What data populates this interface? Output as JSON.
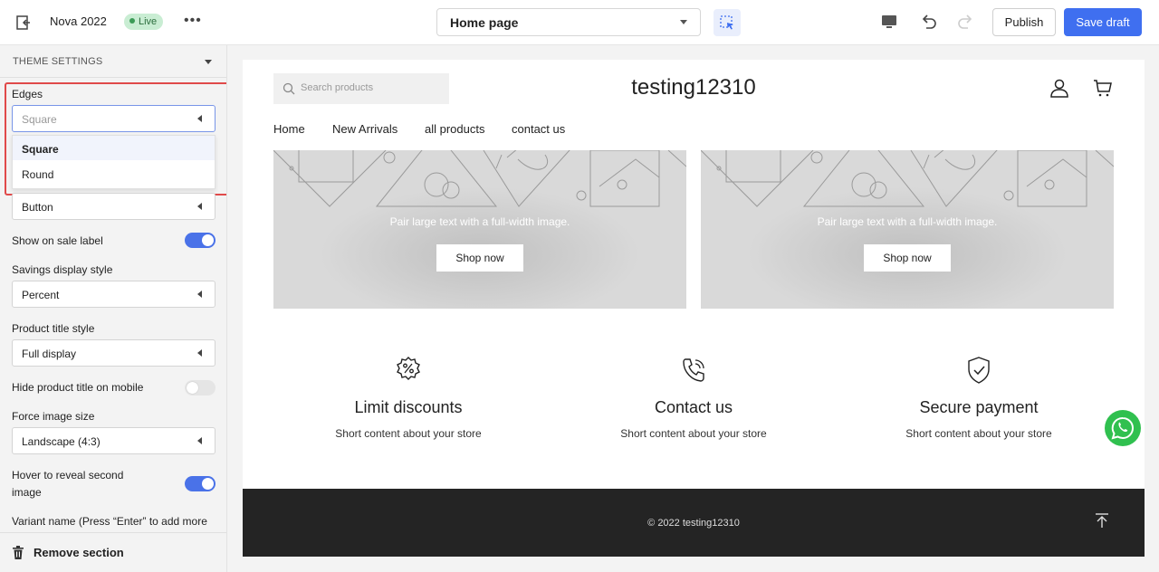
{
  "topbar": {
    "title": "Nova 2022",
    "live_badge": "Live",
    "more": "•••",
    "page_select": "Home page",
    "publish_label": "Publish",
    "save_label": "Save draft"
  },
  "sidebar": {
    "section_title": "THEME SETTINGS",
    "edges_label": "Edges",
    "edges_value": "Square",
    "edges_options": [
      "Square",
      "Round"
    ],
    "button_select": "Button",
    "show_on_sale_label": "Show on sale label",
    "show_on_sale": true,
    "savings_label": "Savings display style",
    "savings_value": "Percent",
    "title_style_label": "Product title style",
    "title_style_value": "Full display",
    "hide_title_label": "Hide product title on mobile",
    "hide_title": false,
    "force_size_label": "Force image size",
    "force_size_value": "Landscape (4:3)",
    "hover_label_1": "Hover to reveal second",
    "hover_label_2": "image",
    "hover_reveal": true,
    "variant_label": "Variant name (Press “Enter” to add more",
    "remove_label": "Remove section"
  },
  "preview": {
    "search_placeholder": "Search products",
    "store_name": "testing12310",
    "nav": [
      "Home",
      "New Arrivals",
      "all products",
      "contact us"
    ],
    "banners": [
      {
        "text": "Pair large text with a full-width image.",
        "button": "Shop now"
      },
      {
        "text": "Pair large text with a full-width image.",
        "button": "Shop now"
      }
    ],
    "features": [
      {
        "icon": "discount-badge-icon",
        "title": "Limit discounts",
        "subtitle": "Short content about your store"
      },
      {
        "icon": "phone-icon",
        "title": "Contact us",
        "subtitle": "Short content about your store"
      },
      {
        "icon": "shield-check-icon",
        "title": "Secure payment",
        "subtitle": "Short content about your store"
      }
    ],
    "footer_copy": "© 2022 testing12310"
  },
  "colors": {
    "accent": "#3f6ff0",
    "highlight": "#e04a4a",
    "live_badge": "#c9edd3",
    "whatsapp": "#30c04f"
  }
}
